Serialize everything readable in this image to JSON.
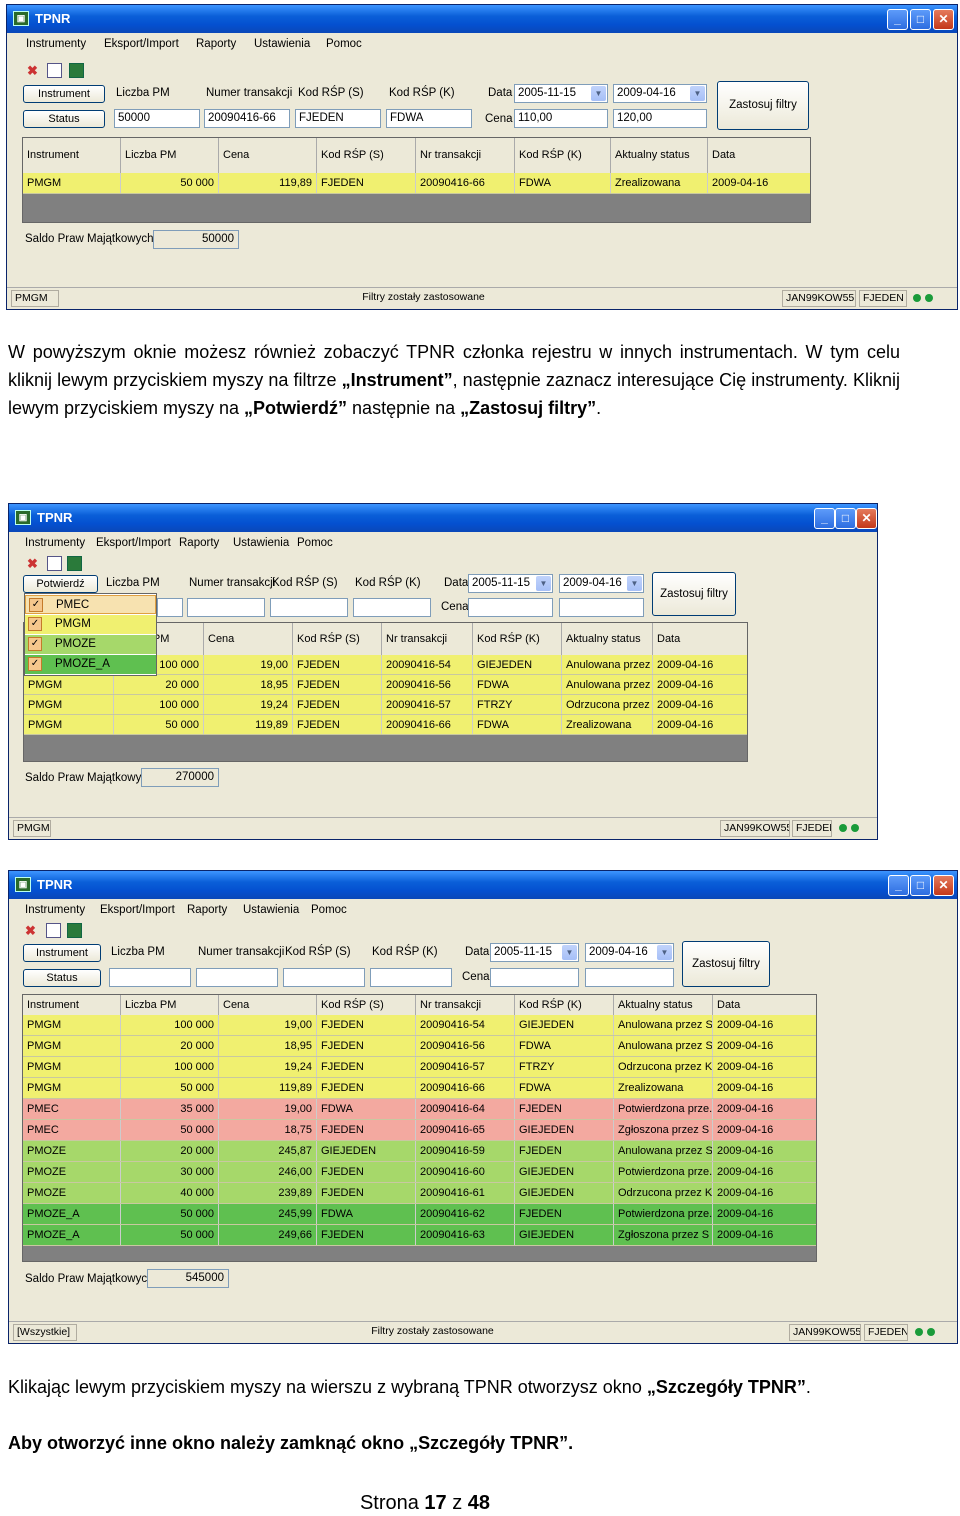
{
  "menu": [
    "Instrumenty",
    "Eksport/Import",
    "Raporty",
    "Ustawienia",
    "Pomoc"
  ],
  "win1": {
    "title": "TPNR",
    "btn_instrument": "Instrument",
    "btn_status": "Status",
    "lbl_liczba": "Liczba PM",
    "lbl_numer": "Numer transakcji",
    "lbl_kodS": "Kod RŚP (S)",
    "lbl_kodK": "Kod RŚP (K)",
    "lbl_data": "Data",
    "lbl_cena": "Cena",
    "val_liczba": "50000",
    "val_numer": "20090416-66",
    "val_kodS": "FJEDEN",
    "val_kodK": "FDWA",
    "val_data1": "2005-11-15",
    "val_data2": "2009-04-16",
    "val_cena1": "110,00",
    "val_cena2": "120,00",
    "apply": "Zastosuj filtry",
    "headers": [
      "Instrument",
      "Liczba PM",
      "Cena",
      "Kod RŚP (S)",
      "Nr transakcji",
      "Kod RŚP (K)",
      "Aktualny status",
      "Data"
    ],
    "rows": [
      [
        "PMGM",
        "50 000",
        "119,89",
        "FJEDEN",
        "20090416-66",
        "FDWA",
        "Zrealizowana",
        "2009-04-16"
      ]
    ],
    "saldo_label": "Saldo Praw Majątkowych:",
    "saldo": "50000",
    "status_left": "PMGM",
    "status_mid": "Filtry zostały zastosowane",
    "status_user": "JAN99KOW55",
    "status_code": "FJEDEN"
  },
  "para1": "W powyższym oknie możesz również zobaczyć  TPNR członka rejestru  w innych instrumentach. W tym celu kliknij lewym przyciskiem myszy na filtrze „Instrument”, następnie zaznacz interesujące Cię instrumenty. Kliknij lewym przyciskiem myszy na „Potwierdź” następnie na „Zastosuj filtry”.",
  "win2": {
    "title": "TPNR",
    "btn_confirm": "Potwierdź",
    "lbl_liczba": "Liczba PM",
    "lbl_numer": "Numer transakcji",
    "lbl_kodS": "Kod RŚP (S)",
    "lbl_kodK": "Kod RŚP (K)",
    "lbl_data": "Data",
    "lbl_cena": "Cena",
    "val_data1": "2005-11-15",
    "val_data2": "2009-04-16",
    "apply": "Zastosuj filtry",
    "popup": [
      "PMEC",
      "PMGM",
      "PMOZE",
      "PMOZE_A"
    ],
    "headers": [
      "",
      "Liczba PM",
      "Cena",
      "Kod RŚP (S)",
      "Nr transakcji",
      "Kod RŚP (K)",
      "Aktualny status",
      "Data"
    ],
    "rows": [
      [
        "PMGM",
        "100 000",
        "19,00",
        "FJEDEN",
        "20090416-54",
        "GIEJEDEN",
        "Anulowana przez S",
        "2009-04-16"
      ],
      [
        "PMGM",
        "20 000",
        "18,95",
        "FJEDEN",
        "20090416-56",
        "FDWA",
        "Anulowana przez S",
        "2009-04-16"
      ],
      [
        "PMGM",
        "100 000",
        "19,24",
        "FJEDEN",
        "20090416-57",
        "FTRZY",
        "Odrzucona przez K",
        "2009-04-16"
      ],
      [
        "PMGM",
        "50 000",
        "119,89",
        "FJEDEN",
        "20090416-66",
        "FDWA",
        "Zrealizowana",
        "2009-04-16"
      ]
    ],
    "saldo_label": "Saldo Praw Majątkowych:",
    "saldo": "270000",
    "status_left": "PMGM",
    "status_user": "JAN99KOW55",
    "status_code": "FJEDEN"
  },
  "win3": {
    "title": "TPNR",
    "btn_instrument": "Instrument",
    "btn_status": "Status",
    "lbl_liczba": "Liczba PM",
    "lbl_numer": "Numer transakcji",
    "lbl_kodS": "Kod RŚP (S)",
    "lbl_kodK": "Kod RŚP (K)",
    "lbl_data": "Data",
    "lbl_cena": "Cena",
    "val_data1": "2005-11-15",
    "val_data2": "2009-04-16",
    "apply": "Zastosuj filtry",
    "headers": [
      "Instrument",
      "Liczba PM",
      "Cena",
      "Kod RŚP (S)",
      "Nr transakcji",
      "Kod RŚP (K)",
      "Aktualny status",
      "Data"
    ],
    "rows": [
      [
        "PMGM",
        "100 000",
        "19,00",
        "FJEDEN",
        "20090416-54",
        "GIEJEDEN",
        "Anulowana przez S",
        "2009-04-16"
      ],
      [
        "PMGM",
        "20 000",
        "18,95",
        "FJEDEN",
        "20090416-56",
        "FDWA",
        "Anulowana przez S",
        "2009-04-16"
      ],
      [
        "PMGM",
        "100 000",
        "19,24",
        "FJEDEN",
        "20090416-57",
        "FTRZY",
        "Odrzucona przez K",
        "2009-04-16"
      ],
      [
        "PMGM",
        "50 000",
        "119,89",
        "FJEDEN",
        "20090416-66",
        "FDWA",
        "Zrealizowana",
        "2009-04-16"
      ],
      [
        "PMEC",
        "35 000",
        "19,00",
        "FDWA",
        "20090416-64",
        "FJEDEN",
        "Potwierdzona prze...",
        "2009-04-16"
      ],
      [
        "PMEC",
        "50 000",
        "18,75",
        "FJEDEN",
        "20090416-65",
        "GIEJEDEN",
        "Zgłoszona przez S",
        "2009-04-16"
      ],
      [
        "PMOZE",
        "20 000",
        "245,87",
        "GIEJEDEN",
        "20090416-59",
        "FJEDEN",
        "Anulowana przez S",
        "2009-04-16"
      ],
      [
        "PMOZE",
        "30 000",
        "246,00",
        "FJEDEN",
        "20090416-60",
        "GIEJEDEN",
        "Potwierdzona prze...",
        "2009-04-16"
      ],
      [
        "PMOZE",
        "40 000",
        "239,89",
        "FJEDEN",
        "20090416-61",
        "GIEJEDEN",
        "Odrzucona przez K",
        "2009-04-16"
      ],
      [
        "PMOZE_A",
        "50 000",
        "245,99",
        "FDWA",
        "20090416-62",
        "FJEDEN",
        "Potwierdzona prze...",
        "2009-04-16"
      ],
      [
        "PMOZE_A",
        "50 000",
        "249,66",
        "FJEDEN",
        "20090416-63",
        "GIEJEDEN",
        "Zgłoszona przez S",
        "2009-04-16"
      ]
    ],
    "saldo_label": "Saldo Praw Majątkowych:",
    "saldo": "545000",
    "status_left": "[Wszystkie]",
    "status_mid": "Filtry zostały zastosowane",
    "status_user": "JAN99KOW55",
    "status_code": "FJEDEN"
  },
  "para2": "Klikając lewym przyciskiem myszy na wierszu z wybraną TPNR otworzysz okno „Szczegóły TPNR”.",
  "para3": "Aby otworzyć inne okno należy zamknąć okno „Szczegóły TPNR”.",
  "footer": {
    "prefix": "Strona ",
    "page": "17",
    "mid": " z ",
    "total": "48"
  },
  "colors": {
    "yellow": "#f0f070",
    "pmec": "#f3a9a0",
    "pmoze": "#a6d86a",
    "pmoze_a": "#5fc050",
    "xp_blue": "#0a5fd8"
  }
}
